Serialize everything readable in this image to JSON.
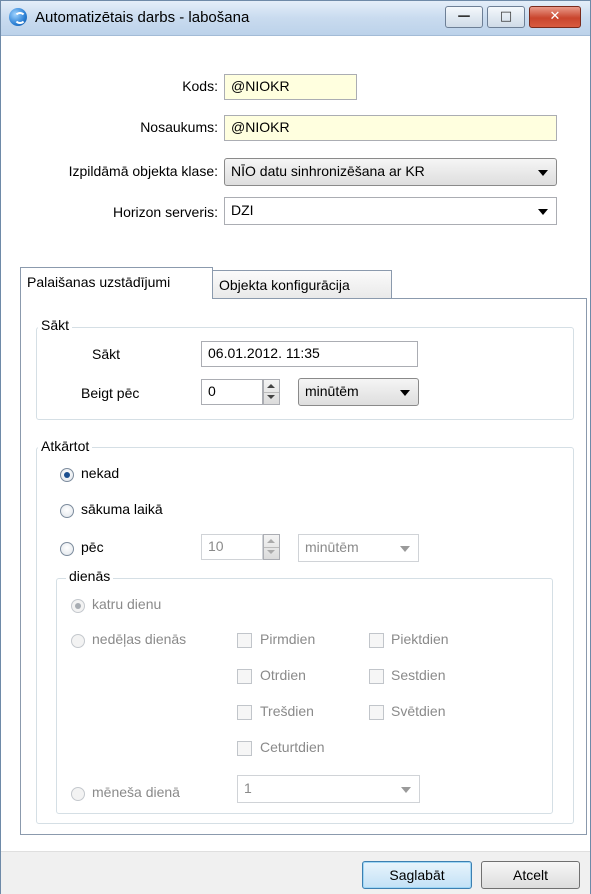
{
  "window": {
    "title": "Automatizētais darbs - labošana"
  },
  "form": {
    "kods_label": "Kods:",
    "kods_value": "@NIOKR",
    "nosaukums_label": "Nosaukums:",
    "nosaukums_value": "@NIOKR",
    "klase_label": "Izpildāmā objekta klase:",
    "klase_value": "NĪO datu sinhronizēšana ar KR",
    "serveris_label": "Horizon serveris:",
    "serveris_value": "DZI"
  },
  "tabs": [
    {
      "label": "Palaišanas uzstādījumi",
      "active": true
    },
    {
      "label": "Objekta konfigurācija",
      "active": false
    }
  ],
  "start": {
    "group_label": "Sākt",
    "sakt_label": "Sākt",
    "sakt_value": "06.01.2012. 11:35",
    "beigt_label": "Beigt pēc",
    "beigt_value": "0",
    "beigt_unit": "minūtēm"
  },
  "repeat": {
    "group_label": "Atkārtot",
    "options": [
      {
        "label": "nekad",
        "selected": true
      },
      {
        "label": "sākuma laikā",
        "selected": false
      },
      {
        "label": "pēc",
        "selected": false
      }
    ],
    "pec_value": "10",
    "pec_unit": "minūtēm"
  },
  "days": {
    "group_label": "dienās",
    "katru_dienu": "katru dienu",
    "nedelas_dienas": "nedēļas dienās",
    "weekdays": [
      "Pirmdien",
      "Otrdien",
      "Trešdien",
      "Ceturtdien",
      "Piektdien",
      "Sestdien",
      "Svētdien"
    ],
    "menesa_diena": "mēneša dienā",
    "menesa_value": "1"
  },
  "buttons": {
    "save": "Saglabāt",
    "cancel": "Atcelt"
  },
  "colors": {
    "accent": "#3c7fb1",
    "field_yellow": "#ffffdf",
    "disabled_text": "#8a8a8a"
  }
}
